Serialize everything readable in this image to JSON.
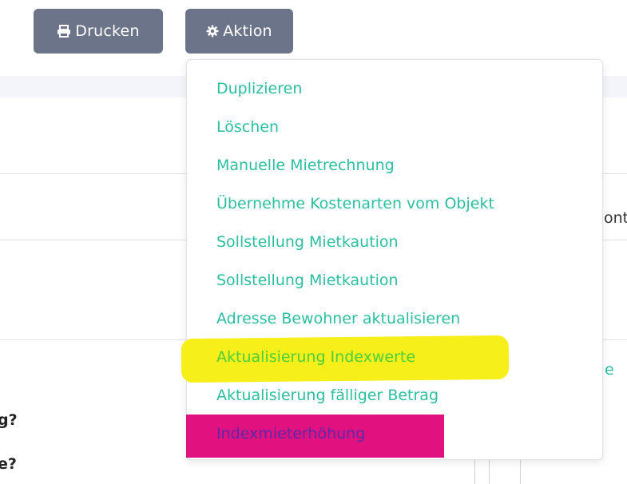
{
  "toolbar": {
    "print_label": "Drucken",
    "action_label": "Aktion"
  },
  "background": {
    "right_fragment_1": "ont",
    "right_fragment_2": "e",
    "left_fragment_1": "g?",
    "left_fragment_2": "e?"
  },
  "menu": {
    "items": [
      {
        "label": "Duplizieren"
      },
      {
        "label": "Löschen"
      },
      {
        "label": "Manuelle Mietrechnung"
      },
      {
        "label": "Übernehme Kostenarten vom Objekt"
      },
      {
        "label": "Sollstellung Mietkaution"
      },
      {
        "label": "Sollstellung Mietkaution"
      },
      {
        "label": "Adresse Bewohner aktualisieren"
      },
      {
        "label": "Aktualisierung Indexwerte"
      },
      {
        "label": "Aktualisierung fälliger Betrag"
      },
      {
        "label": "Indexmieterhöhung"
      }
    ]
  },
  "annotations": {
    "yellow": "#f7ef1a",
    "magenta": "#e1117f"
  },
  "colors": {
    "button_bg": "#6c7489",
    "menu_text": "#2bbfa0"
  }
}
